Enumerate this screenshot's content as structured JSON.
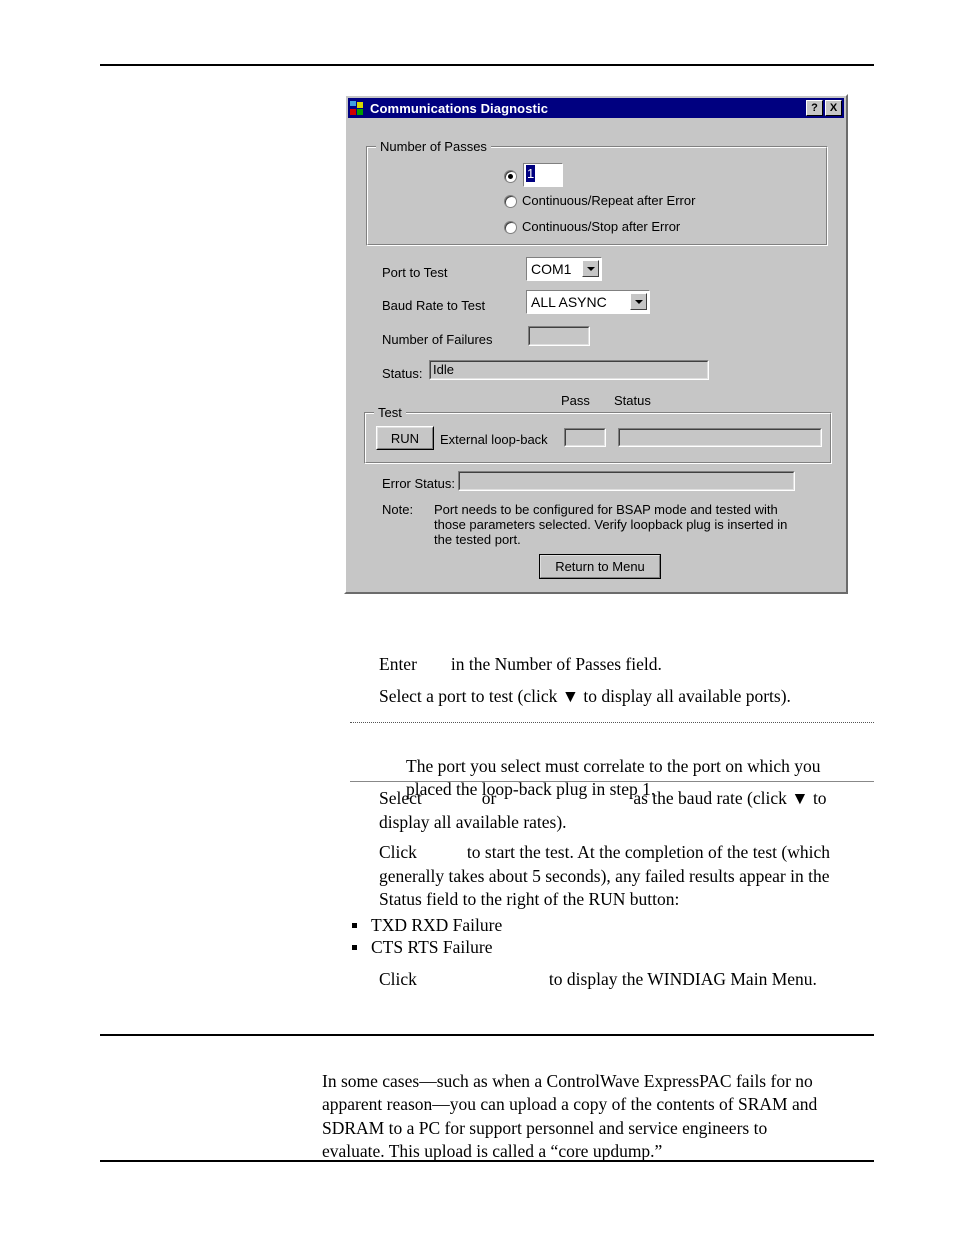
{
  "dialog": {
    "title": "Communications Diagnostic",
    "title_buttons": [
      {
        "name": "help-button",
        "label": "?"
      },
      {
        "name": "close-button",
        "label": "X"
      }
    ],
    "number_of_passes": {
      "legend": "Number of Passes",
      "passes_value": "1",
      "options": [
        {
          "label": "",
          "selected": true
        },
        {
          "label": "Continuous/Repeat after Error",
          "selected": false
        },
        {
          "label": "Continuous/Stop after  Error",
          "selected": false
        }
      ]
    },
    "port_to_test": {
      "label": "Port to Test",
      "value": "COM1"
    },
    "baud_rate_to_test": {
      "label": "Baud Rate to Test",
      "value": "ALL ASYNC"
    },
    "number_of_failures": {
      "label": "Number of Failures",
      "value": ""
    },
    "status": {
      "label": "Status:",
      "value": "Idle"
    },
    "column_headers": {
      "pass": "Pass",
      "status": "Status"
    },
    "test_group": {
      "legend": "Test",
      "run_button": "RUN",
      "test_name": "External loop-back",
      "pass_value": "",
      "status_value": ""
    },
    "error_status": {
      "label": "Error Status:",
      "value": ""
    },
    "note": {
      "label": "Note:",
      "text": "Port needs to be configured for BSAP mode and tested with\nthose parameters selected. Verify loopback plug is inserted in\nthe tested port."
    },
    "return_button": "Return to Menu"
  },
  "document": {
    "step_enter": {
      "part1": "Enter",
      "part2": "in the Number of Passes field."
    },
    "step_select_port": "Select a port to test (click ▼ to display all available ports).",
    "callout": "The port you select must correlate to the port on which you\nplaced the loop-back plug in step 1.",
    "step_baud": {
      "part1": "Select",
      "part2": "or",
      "part3": "as the baud rate (click ▼ to",
      "line2": "display all available rates)."
    },
    "step_click_run": {
      "part1": "Click",
      "part2": "to start the test. At the completion of the test (which",
      "line2": "generally takes about 5 seconds), any failed results appear in the",
      "line3": "Status field to the right of the RUN button:"
    },
    "failure_bullets": [
      "TXD RXD Failure",
      "CTS RTS Failure"
    ],
    "step_click_return": {
      "part1": "Click",
      "part2": "to display the WINDIAG Main Menu."
    },
    "closing_paragraph": "In some cases—such as when a ControlWave ExpressPAC fails for no\napparent reason—you can upload a copy of the contents of SRAM and\nSDRAM to a PC for support personnel and service engineers to\nevaluate. This upload is called a “core updump.”"
  }
}
